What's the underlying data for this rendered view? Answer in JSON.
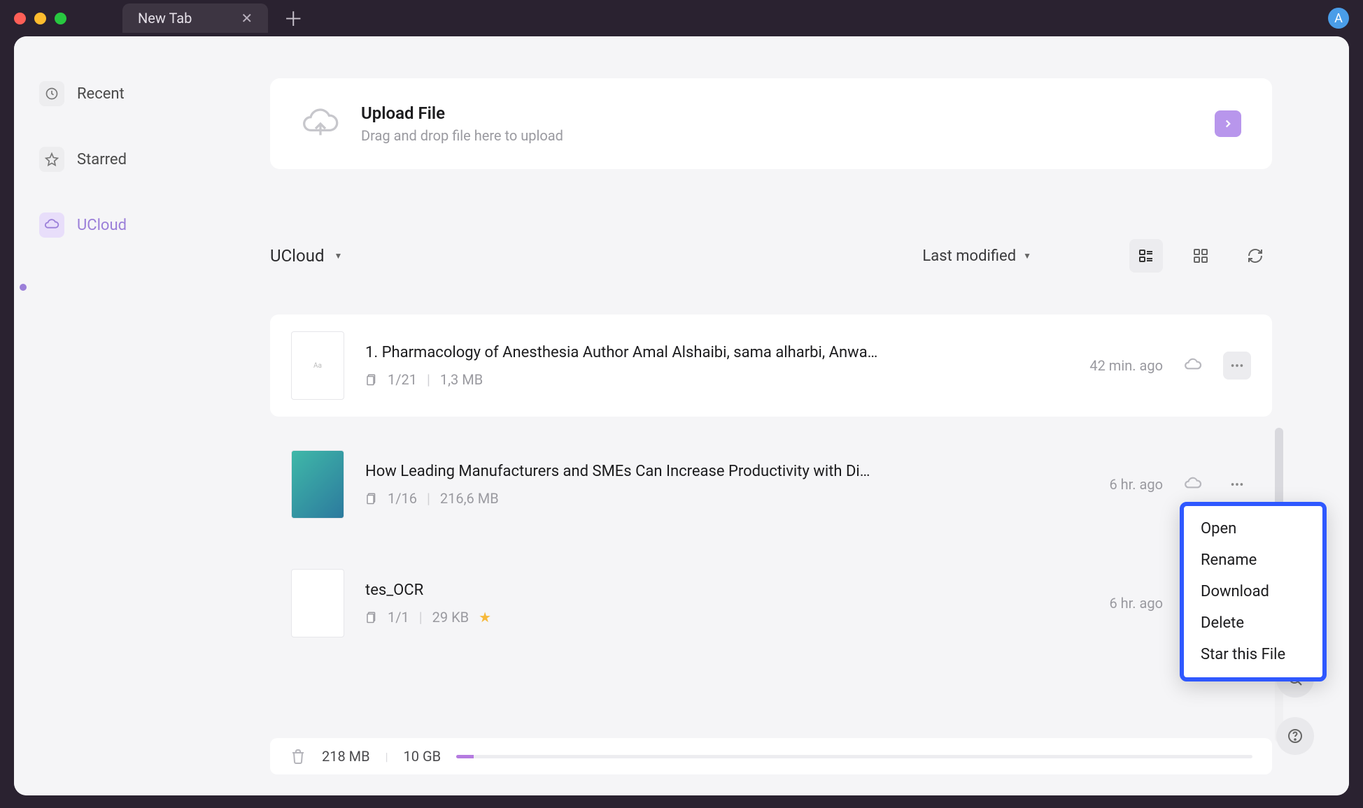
{
  "chrome": {
    "tab_title": "New Tab",
    "avatar_initial": "A"
  },
  "sidebar": {
    "items": [
      {
        "label": "Recent"
      },
      {
        "label": "Starred"
      },
      {
        "label": "UCloud"
      }
    ]
  },
  "upload": {
    "title": "Upload File",
    "subtitle": "Drag and drop file here to upload"
  },
  "toolbar": {
    "breadcrumb": "UCloud",
    "sort_label": "Last modified"
  },
  "files": [
    {
      "name": "1. Pharmacology of Anesthesia Author Amal Alshaibi, sama alharbi, Anwa…",
      "pages": "1/21",
      "size": "1,3 MB",
      "time": "42 min. ago",
      "starred": false
    },
    {
      "name": "How Leading Manufacturers and SMEs Can Increase Productivity with Di…",
      "pages": "1/16",
      "size": "216,6 MB",
      "time": "6 hr. ago",
      "starred": false
    },
    {
      "name": "tes_OCR",
      "pages": "1/1",
      "size": "29 KB",
      "time": "6 hr. ago",
      "starred": true
    }
  ],
  "context_menu": {
    "items": [
      "Open",
      "Rename",
      "Download",
      "Delete",
      "Star this File"
    ]
  },
  "storage": {
    "used": "218 MB",
    "total": "10 GB"
  }
}
